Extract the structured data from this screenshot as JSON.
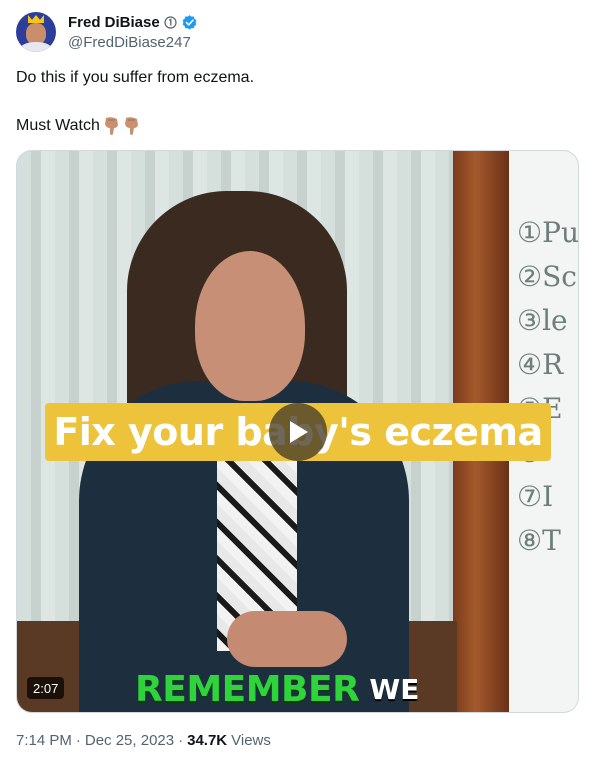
{
  "author": {
    "display_name": "Fred DiBiase",
    "handle": "@FredDiBiase247",
    "verified": true
  },
  "tweet": {
    "line1": "Do this if you suffer from eczema.",
    "line2": "Must Watch",
    "emoji_icons": [
      "pointing-down-icon",
      "pointing-down-icon"
    ]
  },
  "video": {
    "caption_top": "Fix your baby's eczema",
    "caption_bottom_green": "REMEMBER",
    "caption_bottom_white": "WE",
    "duration": "2:07",
    "whiteboard_lines": [
      "①Pu",
      "②Sc",
      "③le",
      "④R",
      "⑤E",
      "⑥",
      "⑦I",
      "⑧T"
    ]
  },
  "meta": {
    "time": "7:14 PM",
    "separator": "·",
    "date": "Dec 25, 2023",
    "views_count": "34.7K",
    "views_label": "Views"
  },
  "colors": {
    "verified_blue": "#1d9bf0",
    "caption_banner": "#ecc33b",
    "caption_green": "#2fd33c",
    "muted_text": "#536471"
  }
}
